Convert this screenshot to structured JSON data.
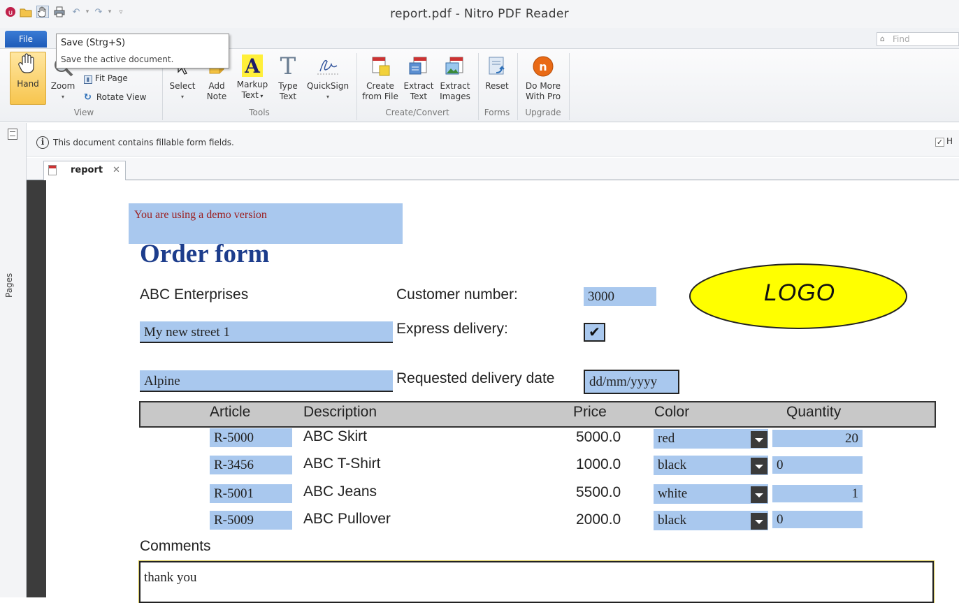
{
  "window": {
    "title": "report.pdf - Nitro PDF Reader"
  },
  "ribbon": {
    "file_tab": "File",
    "find_placeholder": "Find",
    "groups": {
      "view": "View",
      "tools": "Tools",
      "create_convert": "Create/Convert",
      "forms": "Forms",
      "upgrade": "Upgrade"
    },
    "buttons": {
      "hand": "Hand",
      "zoom": "Zoom",
      "fit_page": "Fit Page",
      "rotate_view": "Rotate View",
      "select": "Select",
      "add_note_1": "Add",
      "add_note_2": "Note",
      "markup_text_1": "Markup",
      "markup_text_2": "Text",
      "type_text_1": "Type",
      "type_text_2": "Text",
      "quicksign": "QuickSign",
      "create_from_file_1": "Create",
      "create_from_file_2": "from File",
      "extract_text_1": "Extract",
      "extract_text_2": "Text",
      "extract_images_1": "Extract",
      "extract_images_2": "Images",
      "reset": "Reset",
      "do_more_1": "Do More",
      "do_more_2": "With Pro"
    },
    "tooltip": {
      "title": "Save (Strg+S)",
      "description": "Save the active document."
    }
  },
  "infobar": {
    "message": "This document contains fillable form fields.",
    "highlight_label": "H"
  },
  "pages_panel": {
    "label": "Pages"
  },
  "doc_tab": {
    "name": "report"
  },
  "document": {
    "demo_notice": "You are using a demo version",
    "title": "Order form",
    "company": "ABC Enterprises",
    "street": "My new street 1",
    "city": "Alpine",
    "customer_number_label": "Customer number:",
    "customer_number": "3000",
    "express_label": "Express delivery:",
    "express_checked": "✔",
    "delivery_date_label": "Requested delivery date",
    "delivery_date_placeholder": "dd/mm/yyyy",
    "logo": "LOGO",
    "table": {
      "headers": {
        "article": "Article",
        "description": "Description",
        "price": "Price",
        "color": "Color",
        "quantity": "Quantity"
      },
      "rows": [
        {
          "article": "R-5000",
          "description": "ABC Skirt",
          "price": "5000.0",
          "color": "red",
          "quantity": "20"
        },
        {
          "article": "R-3456",
          "description": "ABC T-Shirt",
          "price": "1000.0",
          "color": "black",
          "quantity": "0"
        },
        {
          "article": "R-5001",
          "description": "ABC Jeans",
          "price": "5500.0",
          "color": "white",
          "quantity": "1"
        },
        {
          "article": "R-5009",
          "description": "ABC Pullover",
          "price": "2000.0",
          "color": "black",
          "quantity": "0"
        }
      ]
    },
    "comments_label": "Comments",
    "comments_value": "thank you"
  }
}
